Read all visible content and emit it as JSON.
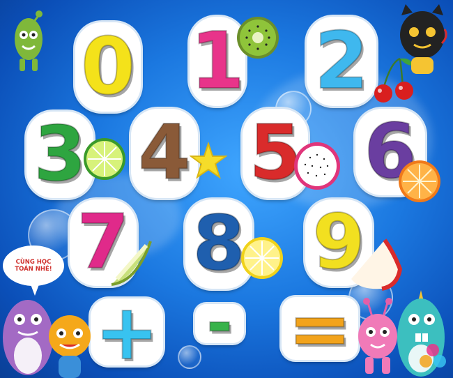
{
  "scene": {
    "numbers": [
      {
        "label": "0",
        "color": "#f4e21a"
      },
      {
        "label": "1",
        "color": "#e8348a"
      },
      {
        "label": "2",
        "color": "#3fb8ee"
      },
      {
        "label": "3",
        "color": "#2ea540"
      },
      {
        "label": "4",
        "color": "#8a5a38"
      },
      {
        "label": "5",
        "color": "#d92b2b"
      },
      {
        "label": "6",
        "color": "#6a3ea0"
      },
      {
        "label": "7",
        "color": "#e02a8a"
      },
      {
        "label": "8",
        "color": "#1f5fae"
      },
      {
        "label": "9",
        "color": "#f2e020"
      }
    ],
    "operators": [
      {
        "label": "+",
        "color": "#38c3f0",
        "name": "plus"
      },
      {
        "label": "-",
        "color": "#37b34a",
        "name": "minus"
      },
      {
        "label": "=",
        "color": "#f2a31c",
        "name": "equals"
      }
    ],
    "speech_bubble": "CÙNG HỌC TOÁN NHÉ!"
  }
}
